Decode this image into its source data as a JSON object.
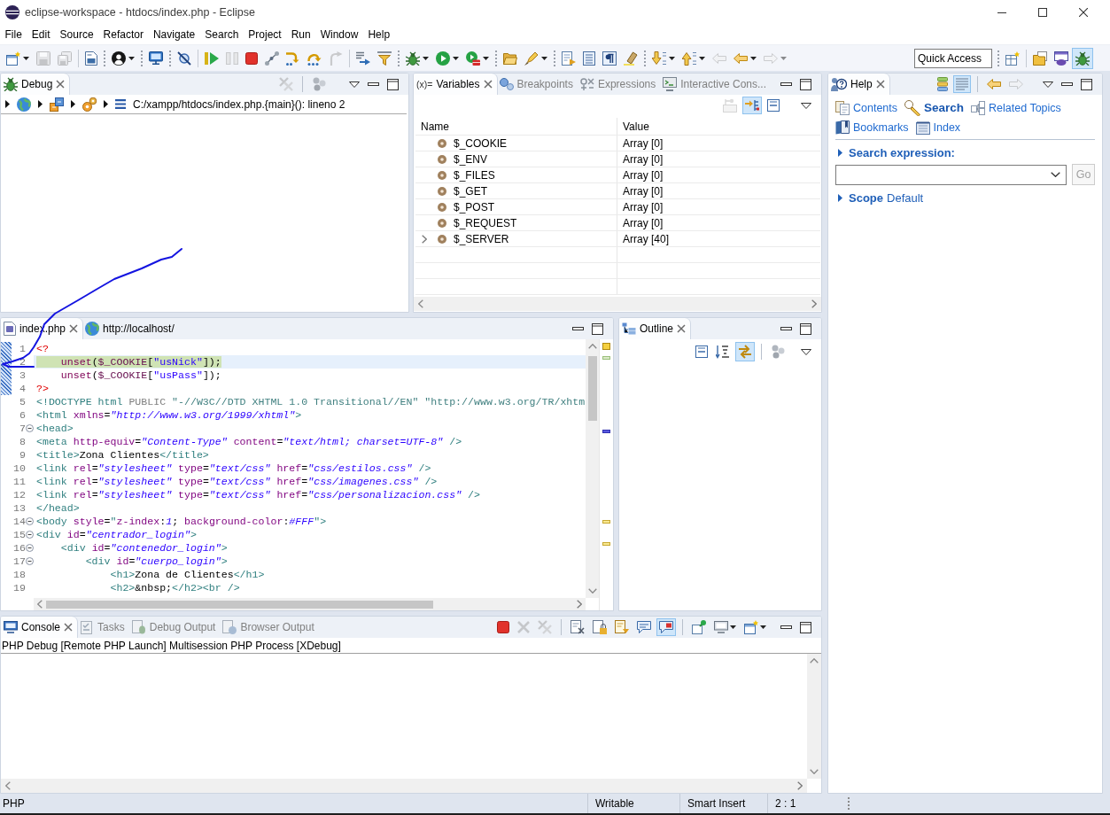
{
  "window": {
    "title": "eclipse-workspace - htdocs/index.php - Eclipse"
  },
  "menu": [
    "File",
    "Edit",
    "Source",
    "Refactor",
    "Navigate",
    "Search",
    "Project",
    "Run",
    "Window",
    "Help"
  ],
  "toolbar": [
    {
      "kind": "button",
      "disabled": false,
      "dropdown": true
    },
    {
      "kind": "button",
      "disabled": true,
      "dropdown": false
    },
    {
      "kind": "button",
      "disabled": true,
      "dropdown": false
    },
    {
      "kind": "separator"
    },
    {
      "kind": "button",
      "disabled": false,
      "dropdown": false
    },
    {
      "kind": "grip"
    },
    {
      "kind": "button",
      "disabled": false,
      "dropdown": true
    },
    {
      "kind": "grip"
    },
    {
      "kind": "button",
      "disabled": false,
      "dropdown": false
    },
    {
      "kind": "grip"
    },
    {
      "kind": "button",
      "disabled": false,
      "dropdown": false
    },
    {
      "kind": "separator"
    },
    {
      "kind": "button",
      "disabled": false,
      "dropdown": false
    },
    {
      "kind": "button",
      "disabled": true,
      "dropdown": false
    },
    {
      "kind": "button",
      "disabled": false,
      "dropdown": false
    },
    {
      "kind": "button",
      "disabled": false,
      "dropdown": false
    },
    {
      "kind": "button",
      "disabled": false,
      "dropdown": false
    },
    {
      "kind": "button",
      "disabled": false,
      "dropdown": false
    },
    {
      "kind": "button",
      "disabled": true,
      "dropdown": false
    },
    {
      "kind": "separator"
    },
    {
      "kind": "button",
      "disabled": false,
      "dropdown": false
    },
    {
      "kind": "button",
      "disabled": false,
      "dropdown": false
    },
    {
      "kind": "grip"
    },
    {
      "kind": "button",
      "disabled": false,
      "dropdown": true
    },
    {
      "kind": "button",
      "disabled": false,
      "dropdown": true
    },
    {
      "kind": "button",
      "disabled": false,
      "dropdown": true
    },
    {
      "kind": "grip"
    },
    {
      "kind": "button",
      "disabled": false,
      "dropdown": false
    },
    {
      "kind": "button",
      "disabled": false,
      "dropdown": true
    },
    {
      "kind": "grip"
    },
    {
      "kind": "button",
      "disabled": false,
      "dropdown": false
    },
    {
      "kind": "button",
      "disabled": false,
      "dropdown": false
    },
    {
      "kind": "button",
      "disabled": false,
      "dropdown": false
    },
    {
      "kind": "button",
      "disabled": false,
      "dropdown": false
    },
    {
      "kind": "grip"
    },
    {
      "kind": "button",
      "disabled": false,
      "dropdown": true
    },
    {
      "kind": "button",
      "disabled": false,
      "dropdown": true
    },
    {
      "kind": "button",
      "disabled": true,
      "dropdown": false
    },
    {
      "kind": "button",
      "disabled": false,
      "dropdown": true
    },
    {
      "kind": "button",
      "disabled": true,
      "dropdown": true
    }
  ],
  "quick_access": {
    "placeholder": "Quick Access"
  },
  "perspectives": [
    {
      "selected": false
    },
    {
      "selected": false
    },
    {
      "selected": true
    }
  ],
  "debug_view": {
    "tabs": [
      {
        "label": "Debug",
        "selected": true
      }
    ],
    "tools": [
      {
        "selected": false,
        "disabled": true
      },
      {
        "selected": false,
        "disabled": false
      }
    ],
    "stack_frame": "C:/xampp/htdocs/index.php.{main}(): lineno 2"
  },
  "variables_view": {
    "tabs": [
      {
        "glyph": "(x)=",
        "label": "Variables",
        "selected": true
      },
      {
        "label": "Breakpoints",
        "selected": false
      },
      {
        "label": "Expressions",
        "selected": false
      },
      {
        "label": "Interactive Cons...",
        "selected": false
      }
    ],
    "tools": [
      {
        "selected": false,
        "disabled": true
      },
      {
        "selected": true,
        "disabled": false
      },
      {
        "selected": false,
        "disabled": false
      }
    ],
    "columns": [
      "Name",
      "Value"
    ],
    "rows": [
      {
        "name": "$_COOKIE",
        "value": "Array [0]",
        "expandable": false
      },
      {
        "name": "$_ENV",
        "value": "Array [0]",
        "expandable": false
      },
      {
        "name": "$_FILES",
        "value": "Array [0]",
        "expandable": false
      },
      {
        "name": "$_GET",
        "value": "Array [0]",
        "expandable": false
      },
      {
        "name": "$_POST",
        "value": "Array [0]",
        "expandable": false
      },
      {
        "name": "$_REQUEST",
        "value": "Array [0]",
        "expandable": false
      },
      {
        "name": "$_SERVER",
        "value": "Array [40]",
        "expandable": true
      }
    ]
  },
  "help_view": {
    "tabs": [
      {
        "label": "Help",
        "selected": true
      }
    ],
    "tools": [
      {
        "selected": false,
        "disabled": false
      },
      {
        "selected": true,
        "disabled": false
      },
      {
        "selected": false,
        "disabled": false
      },
      {
        "selected": false,
        "disabled": true
      }
    ],
    "links": [
      {
        "label": "Contents",
        "selected": false
      },
      {
        "label": "Search",
        "selected": true
      },
      {
        "label": "Related Topics",
        "selected": false
      },
      {
        "label": "Bookmarks",
        "selected": false
      },
      {
        "label": "Index",
        "selected": false
      }
    ],
    "search_title": "Search expression:",
    "go_button": {
      "label": "Go",
      "disabled": true
    },
    "scope": {
      "label": "Scope",
      "value": "Default"
    }
  },
  "editor": {
    "tabs": [
      {
        "label": "index.php",
        "selected": true
      },
      {
        "label": "http://localhost/",
        "selected": false
      }
    ],
    "lines": [
      {
        "number": "1",
        "in_range": true,
        "foldable": false,
        "current": false,
        "tokens": [
          {
            "kind": "php-tag",
            "text": "<?"
          }
        ]
      },
      {
        "number": "2",
        "in_range": true,
        "foldable": false,
        "current": true,
        "tokens": [
          {
            "kind": "keyword",
            "text": "    unset"
          },
          {
            "kind": "plain",
            "text": "("
          },
          {
            "kind": "variable",
            "text": "$_COOKIE"
          },
          {
            "kind": "plain",
            "text": "["
          },
          {
            "kind": "string",
            "text": "\"usNick\""
          },
          {
            "kind": "plain",
            "text": "]);"
          }
        ]
      },
      {
        "number": "3",
        "in_range": true,
        "foldable": false,
        "current": false,
        "tokens": [
          {
            "kind": "keyword",
            "text": "    unset"
          },
          {
            "kind": "plain",
            "text": "("
          },
          {
            "kind": "variable",
            "text": "$_COOKIE"
          },
          {
            "kind": "plain",
            "text": "["
          },
          {
            "kind": "string",
            "text": "\"usPass\""
          },
          {
            "kind": "plain",
            "text": "]);"
          }
        ]
      },
      {
        "number": "4",
        "in_range": true,
        "foldable": false,
        "current": false,
        "tokens": [
          {
            "kind": "php-tag",
            "text": "?>"
          }
        ]
      },
      {
        "number": "5",
        "in_range": false,
        "foldable": false,
        "current": false,
        "tokens": [
          {
            "kind": "tag",
            "text": "<!DOCTYPE html "
          },
          {
            "kind": "doctype-keyword",
            "text": "PUBLIC"
          },
          {
            "kind": "doctype",
            "text": " \"-//W3C//DTD XHTML 1.0 Transitional//EN\" \"http://www.w3.org/TR/xhtm"
          }
        ]
      },
      {
        "number": "6",
        "in_range": false,
        "foldable": false,
        "current": false,
        "tokens": [
          {
            "kind": "tag",
            "text": "<html"
          },
          {
            "kind": "attribute",
            "text": " xmlns"
          },
          {
            "kind": "plain",
            "text": "="
          },
          {
            "kind": "value",
            "text": "\"http://www.w3.org/1999/xhtml\""
          },
          {
            "kind": "tag",
            "text": ">"
          }
        ]
      },
      {
        "number": "7",
        "in_range": false,
        "foldable": true,
        "current": false,
        "tokens": [
          {
            "kind": "tag",
            "text": "<head>"
          }
        ]
      },
      {
        "number": "8",
        "in_range": false,
        "foldable": false,
        "current": false,
        "tokens": [
          {
            "kind": "tag",
            "text": "<meta"
          },
          {
            "kind": "attribute",
            "text": " http-equiv"
          },
          {
            "kind": "plain",
            "text": "="
          },
          {
            "kind": "value",
            "text": "\"Content-Type\""
          },
          {
            "kind": "attribute",
            "text": " content"
          },
          {
            "kind": "plain",
            "text": "="
          },
          {
            "kind": "value",
            "text": "\"text/html; charset=UTF-8\""
          },
          {
            "kind": "tag",
            "text": " />"
          }
        ]
      },
      {
        "number": "9",
        "in_range": false,
        "foldable": false,
        "current": false,
        "tokens": [
          {
            "kind": "tag",
            "text": "<title>"
          },
          {
            "kind": "plain",
            "text": "Zona Clientes"
          },
          {
            "kind": "tag",
            "text": "</title>"
          }
        ]
      },
      {
        "number": "10",
        "in_range": false,
        "foldable": false,
        "current": false,
        "tokens": [
          {
            "kind": "tag",
            "text": "<link"
          },
          {
            "kind": "attribute",
            "text": " rel"
          },
          {
            "kind": "plain",
            "text": "="
          },
          {
            "kind": "value",
            "text": "\"stylesheet\""
          },
          {
            "kind": "attribute",
            "text": " type"
          },
          {
            "kind": "plain",
            "text": "="
          },
          {
            "kind": "value",
            "text": "\"text/css\""
          },
          {
            "kind": "attribute",
            "text": " href"
          },
          {
            "kind": "plain",
            "text": "="
          },
          {
            "kind": "value",
            "text": "\"css/estilos.css\""
          },
          {
            "kind": "tag",
            "text": " />"
          }
        ]
      },
      {
        "number": "11",
        "in_range": false,
        "foldable": false,
        "current": false,
        "tokens": [
          {
            "kind": "tag",
            "text": "<link"
          },
          {
            "kind": "attribute",
            "text": " rel"
          },
          {
            "kind": "plain",
            "text": "="
          },
          {
            "kind": "value",
            "text": "\"stylesheet\""
          },
          {
            "kind": "attribute",
            "text": " type"
          },
          {
            "kind": "plain",
            "text": "="
          },
          {
            "kind": "value",
            "text": "\"text/css\""
          },
          {
            "kind": "attribute",
            "text": " href"
          },
          {
            "kind": "plain",
            "text": "="
          },
          {
            "kind": "value",
            "text": "\"css/imagenes.css\""
          },
          {
            "kind": "tag",
            "text": " />"
          }
        ]
      },
      {
        "number": "12",
        "in_range": false,
        "foldable": false,
        "current": false,
        "tokens": [
          {
            "kind": "tag",
            "text": "<link"
          },
          {
            "kind": "attribute",
            "text": " rel"
          },
          {
            "kind": "plain",
            "text": "="
          },
          {
            "kind": "value",
            "text": "\"stylesheet\""
          },
          {
            "kind": "attribute",
            "text": " type"
          },
          {
            "kind": "plain",
            "text": "="
          },
          {
            "kind": "value",
            "text": "\"text/css\""
          },
          {
            "kind": "attribute",
            "text": " href"
          },
          {
            "kind": "plain",
            "text": "="
          },
          {
            "kind": "value",
            "text": "\"css/personalizacion.css\""
          },
          {
            "kind": "tag",
            "text": " />"
          }
        ]
      },
      {
        "number": "13",
        "in_range": false,
        "foldable": false,
        "current": false,
        "tokens": [
          {
            "kind": "tag",
            "text": "</head>"
          }
        ]
      },
      {
        "number": "14",
        "in_range": false,
        "foldable": true,
        "current": false,
        "tokens": [
          {
            "kind": "tag",
            "text": "<body"
          },
          {
            "kind": "attribute",
            "text": " style"
          },
          {
            "kind": "plain",
            "text": "="
          },
          {
            "kind": "tag",
            "text": "\""
          },
          {
            "kind": "attribute",
            "text": "z-index"
          },
          {
            "kind": "plain",
            "text": ":"
          },
          {
            "kind": "value",
            "text": "1"
          },
          {
            "kind": "plain",
            "text": "; "
          },
          {
            "kind": "attribute",
            "text": "background-color"
          },
          {
            "kind": "plain",
            "text": ":"
          },
          {
            "kind": "value",
            "text": "#FFF"
          },
          {
            "kind": "tag",
            "text": "\">"
          }
        ]
      },
      {
        "number": "15",
        "in_range": false,
        "foldable": true,
        "current": false,
        "tokens": [
          {
            "kind": "tag",
            "text": "<div"
          },
          {
            "kind": "attribute",
            "text": " id"
          },
          {
            "kind": "plain",
            "text": "="
          },
          {
            "kind": "value",
            "text": "\"centrador_login\""
          },
          {
            "kind": "tag",
            "text": ">"
          }
        ]
      },
      {
        "number": "16",
        "in_range": false,
        "foldable": true,
        "current": false,
        "tokens": [
          {
            "kind": "tag",
            "text": "    <div"
          },
          {
            "kind": "attribute",
            "text": " id"
          },
          {
            "kind": "plain",
            "text": "="
          },
          {
            "kind": "value",
            "text": "\"contenedor_login\""
          },
          {
            "kind": "tag",
            "text": ">"
          }
        ]
      },
      {
        "number": "17",
        "in_range": false,
        "foldable": true,
        "current": false,
        "tokens": [
          {
            "kind": "tag",
            "text": "        <div"
          },
          {
            "kind": "attribute",
            "text": " id"
          },
          {
            "kind": "plain",
            "text": "="
          },
          {
            "kind": "value",
            "text": "\"cuerpo_login\""
          },
          {
            "kind": "tag",
            "text": ">"
          }
        ]
      },
      {
        "number": "18",
        "in_range": false,
        "foldable": false,
        "current": false,
        "tokens": [
          {
            "kind": "tag",
            "text": "            <h1>"
          },
          {
            "kind": "plain",
            "text": "Zona de Clientes"
          },
          {
            "kind": "tag",
            "text": "</h1>"
          }
        ]
      },
      {
        "number": "19",
        "in_range": false,
        "foldable": false,
        "current": false,
        "tokens": [
          {
            "kind": "tag",
            "text": "            <h2>"
          },
          {
            "kind": "plain",
            "text": "&nbsp;"
          },
          {
            "kind": "tag",
            "text": "</h2><br />"
          }
        ]
      }
    ]
  },
  "outline_view": {
    "tabs": [
      {
        "label": "Outline",
        "selected": true
      }
    ],
    "tools": [
      {
        "selected": false,
        "disabled": false
      },
      {
        "selected": false,
        "disabled": false
      },
      {
        "selected": true,
        "disabled": false
      },
      {
        "selected": false,
        "disabled": false
      }
    ]
  },
  "console_view": {
    "tabs": [
      {
        "label": "Console",
        "selected": true
      },
      {
        "label": "Tasks",
        "selected": false
      },
      {
        "label": "Debug Output",
        "selected": false
      },
      {
        "label": "Browser Output",
        "selected": false
      }
    ],
    "tools": [
      {
        "selected": false,
        "disabled": false
      },
      {
        "selected": false,
        "disabled": true
      },
      {
        "selected": false,
        "disabled": true
      },
      {
        "selected": false,
        "disabled": false
      },
      {
        "selected": false,
        "disabled": false
      },
      {
        "selected": false,
        "disabled": false
      },
      {
        "selected": false,
        "disabled": false
      },
      {
        "selected": true,
        "disabled": false
      },
      {
        "selected": false,
        "disabled": false
      },
      {
        "selected": false,
        "disabled": false
      },
      {
        "selected": false,
        "disabled": false
      }
    ],
    "description": "PHP Debug [Remote PHP Launch] Multisession PHP Process [XDebug]"
  },
  "status_bar": [
    "PHP",
    "Writable",
    "Smart Insert",
    "2 : 1"
  ]
}
